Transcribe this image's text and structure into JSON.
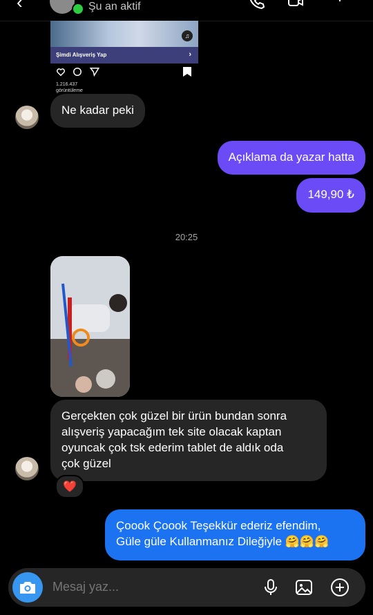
{
  "header": {
    "status": "Şu an aktif"
  },
  "shared_post": {
    "shop_label": "Şimdi Alışveriş Yap",
    "views": "1.216.437",
    "views_label": "görüntüleme"
  },
  "messages": [
    {
      "text": "Ne kadar peki"
    },
    {
      "text": "Açıklama da yazar hatta"
    },
    {
      "text": "149,90 ₺"
    },
    {
      "lines": [
        "Gerçekten çok güzel bir ürün bundan sonra",
        "alışveriş yapacağım tek site olacak kaptan",
        "oyuncak çok tsk ederim tablet de aldık oda",
        "çok güzel"
      ]
    },
    {
      "lines": [
        "Çoook Çoook Teşekkür ederiz efendim,",
        "Güle güle Kullanmanız Dileğiyle 🤗🤗🤗"
      ]
    }
  ],
  "timestamp": "20:25",
  "reaction": "❤️",
  "composer": {
    "placeholder": "Mesaj yaz..."
  },
  "colors": {
    "outgoing_purple": "#6b4bf5",
    "outgoing_blue": "#1c73f2",
    "incoming": "#262626",
    "camera": "#3797f0"
  }
}
